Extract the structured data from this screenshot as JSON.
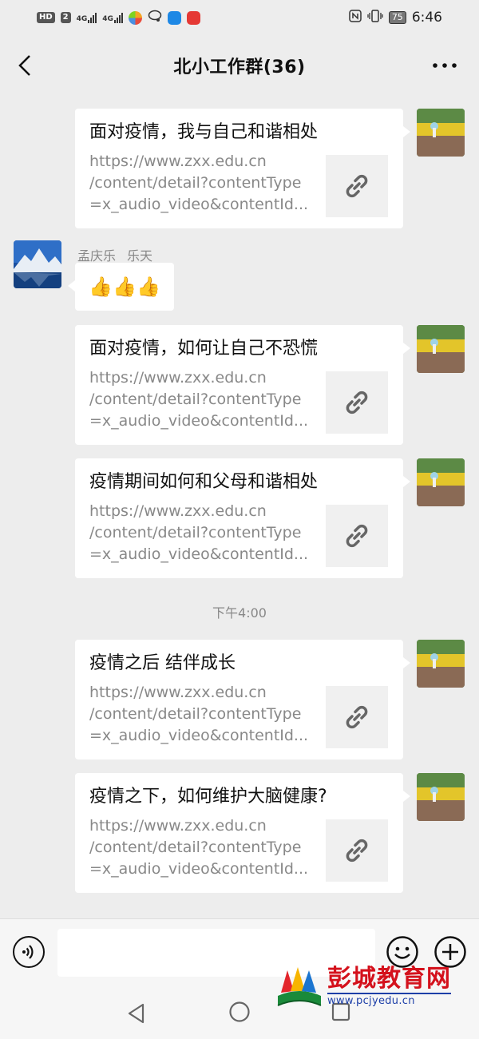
{
  "status_bar": {
    "left_badges": [
      "HD",
      "2"
    ],
    "network_labels": [
      "4G",
      "4G"
    ],
    "battery": "75",
    "time": "6:46"
  },
  "header": {
    "title": "北小工作群(36)",
    "back_icon": "chevron-left-icon",
    "more_icon": "more-dots-icon"
  },
  "messages": [
    {
      "title": "面对疫情，我与自己和谐相处",
      "url_lines": [
        "https://www.zxx.edu.cn",
        "/content/detail?contentType",
        "=x_audio_video&contentId..."
      ]
    },
    {
      "sender": [
        "孟庆乐",
        "乐天"
      ],
      "emoji": "👍👍👍"
    },
    {
      "title": "面对疫情，如何让自己不恐慌",
      "url_lines": [
        "https://www.zxx.edu.cn",
        "/content/detail?contentType",
        "=x_audio_video&contentId..."
      ]
    },
    {
      "title": "疫情期间如何和父母和谐相处",
      "url_lines": [
        "https://www.zxx.edu.cn",
        "/content/detail?contentType",
        "=x_audio_video&contentId..."
      ]
    },
    {
      "timestamp": "下午4:00"
    },
    {
      "title": "疫情之后 结伴成长",
      "url_lines": [
        "https://www.zxx.edu.cn",
        "/content/detail?contentType",
        "=x_audio_video&contentId..."
      ]
    },
    {
      "title": "疫情之下，如何维护大脑健康?",
      "url_lines": [
        "https://www.zxx.edu.cn",
        "/content/detail?contentType",
        "=x_audio_video&contentId..."
      ]
    }
  ],
  "input_bar": {
    "voice_icon": "voice-icon",
    "emoji_icon": "emoji-icon",
    "plus_icon": "plus-icon",
    "text_value": ""
  },
  "watermark": {
    "name": "彭城教育网",
    "url": "www.pcjyedu.cn"
  },
  "colors": {
    "background": "#ededed",
    "card": "#ffffff",
    "url_text": "#888888",
    "watermark_red": "#d4111c",
    "watermark_blue": "#1d3fa8"
  }
}
